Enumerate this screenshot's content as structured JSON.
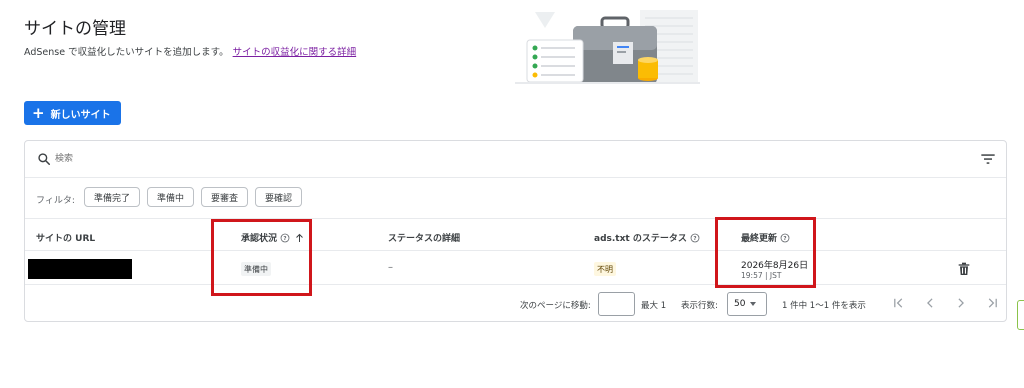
{
  "header": {
    "title": "サイトの管理",
    "subtitle": "AdSense で収益化したいサイトを追加します。",
    "details_link": "サイトの収益化に関する詳細"
  },
  "new_site_button": {
    "label": "新しいサイト"
  },
  "search": {
    "placeholder": "検索"
  },
  "filter": {
    "label": "フィルタ:",
    "chips": [
      "準備完了",
      "準備中",
      "要審査",
      "要確認"
    ]
  },
  "table": {
    "columns": [
      "サイトの URL",
      "承認状況",
      "ステータスの詳細",
      "ads.txt のステータス",
      "最終更新"
    ],
    "rows": [
      {
        "url": "",
        "approval_status": "準備中",
        "status_details": "–",
        "ads_txt_status": "不明",
        "last_updated_date": "2026年8月26日",
        "last_updated_time": "19:57 | JST"
      }
    ]
  },
  "pagination": {
    "go_to_page_label": "次のページに移動:",
    "max_label": "最大 1",
    "rows_per_page_label": "表示行数:",
    "rows_per_page_value": "50",
    "range_text": "1 件中 1〜1 件を表示"
  },
  "colors": {
    "accent": "#1a73e8",
    "highlight": "#d0161b",
    "link": "#7b1fa2",
    "pending_badge_bg": "#f1f3f4",
    "unknown_badge_bg": "#fef7e0"
  },
  "icons": [
    "search-icon",
    "filter-list-icon",
    "help-icon",
    "arrow-up-icon",
    "trash-icon",
    "first-page-icon",
    "chevron-left-icon",
    "chevron-right-icon",
    "last-page-icon"
  ]
}
